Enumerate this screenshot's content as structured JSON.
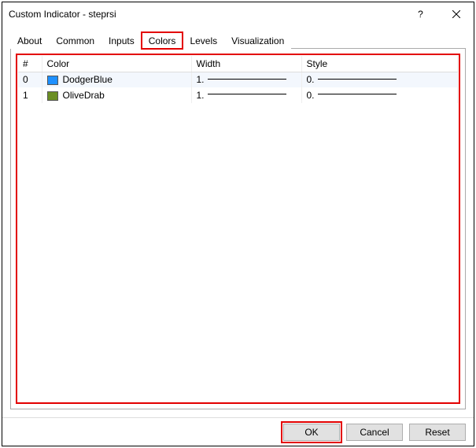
{
  "window": {
    "title": "Custom Indicator - steprsi",
    "help_label": "?",
    "close_label": "✕"
  },
  "tabs": {
    "items": [
      {
        "label": "About"
      },
      {
        "label": "Common"
      },
      {
        "label": "Inputs"
      },
      {
        "label": "Colors"
      },
      {
        "label": "Levels"
      },
      {
        "label": "Visualization"
      }
    ],
    "active_index": 3
  },
  "table": {
    "headers": {
      "idx": "#",
      "color": "Color",
      "width": "Width",
      "style": "Style"
    },
    "rows": [
      {
        "idx": "0",
        "color_name": "DodgerBlue",
        "swatch": "#1e90ff",
        "width": "1.",
        "style": "0."
      },
      {
        "idx": "1",
        "color_name": "OliveDrab",
        "swatch": "#6b8e23",
        "width": "1.",
        "style": "0."
      }
    ]
  },
  "footer": {
    "ok": "OK",
    "cancel": "Cancel",
    "reset": "Reset"
  }
}
